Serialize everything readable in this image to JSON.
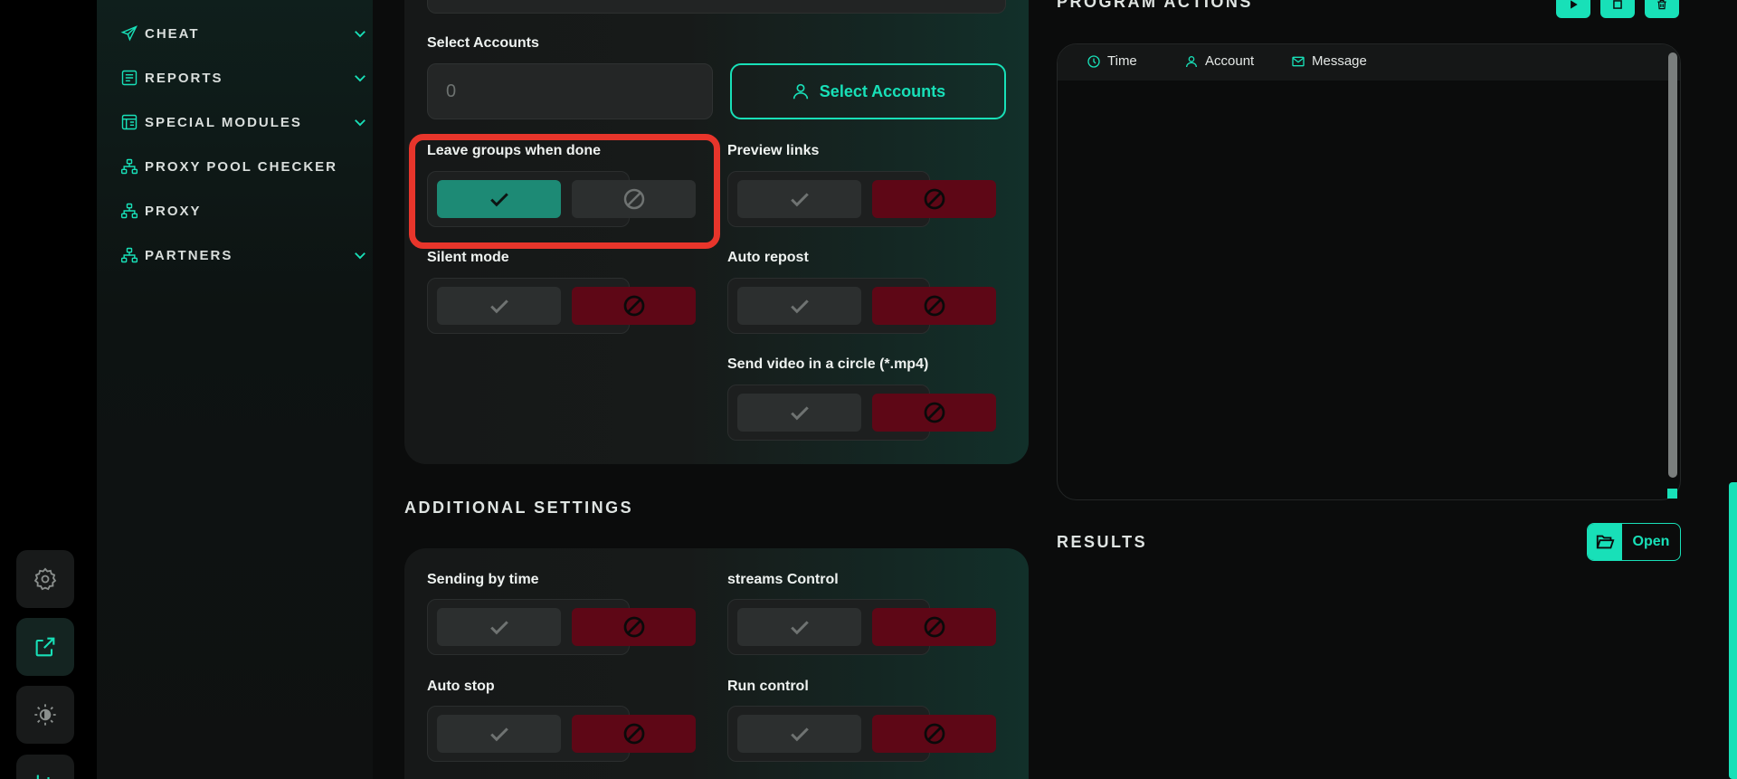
{
  "nav": {
    "items": [
      {
        "label": "CHEAT",
        "icon": "send-icon",
        "has_chevron": true
      },
      {
        "label": "REPORTS",
        "icon": "reports-icon",
        "has_chevron": true
      },
      {
        "label": "SPECIAL MODULES",
        "icon": "modules-icon",
        "has_chevron": true
      },
      {
        "label": "PROXY POOL CHECKER",
        "icon": "network-icon",
        "has_chevron": false
      },
      {
        "label": "PROXY",
        "icon": "network-icon",
        "has_chevron": false
      },
      {
        "label": "PARTNERS",
        "icon": "network-icon",
        "has_chevron": true
      }
    ]
  },
  "rail": {
    "buttons": [
      "settings-icon",
      "external-link-icon",
      "theme-icon",
      "chart-icon"
    ],
    "active": "external-link-icon"
  },
  "main": {
    "select_accounts_label": "Select Accounts",
    "select_accounts_value": "0",
    "select_accounts_button": "Select Accounts",
    "toggles": [
      {
        "label": "Leave groups when done",
        "state": "yes"
      },
      {
        "label": "Preview links",
        "state": "no"
      },
      {
        "label": "Silent mode",
        "state": "no"
      },
      {
        "label": "Auto repost",
        "state": "no"
      },
      {
        "label": "Send video in a circle (*.mp4)",
        "state": "no"
      }
    ],
    "additional_title": "ADDITIONAL SETTINGS",
    "additional_toggles": [
      {
        "label": "Sending by time",
        "state": "no"
      },
      {
        "label": "streams Control",
        "state": "no"
      },
      {
        "label": "Auto stop",
        "state": "no"
      },
      {
        "label": "Run control",
        "state": "no"
      }
    ]
  },
  "right": {
    "actions_title": "PROGRAM ACTIONS",
    "columns": [
      "Time",
      "Account",
      "Message"
    ],
    "results_title": "RESULTS",
    "open_label": "Open"
  },
  "colors": {
    "accent": "#18e0b8",
    "toggle_on": "#1d8a75",
    "toggle_off": "#5e0716",
    "highlight": "#e8352b"
  }
}
